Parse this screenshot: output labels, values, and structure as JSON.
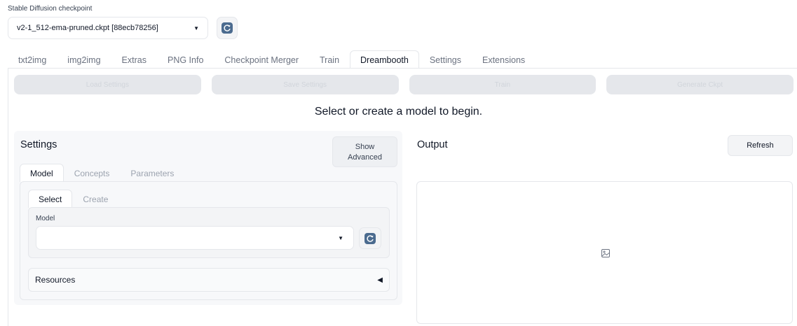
{
  "checkpoint": {
    "label": "Stable Diffusion checkpoint",
    "selected": "v2-1_512-ema-pruned.ckpt [88ecb78256]",
    "refresh_icon": "refresh-icon"
  },
  "tabs": [
    {
      "label": "txt2img"
    },
    {
      "label": "img2img"
    },
    {
      "label": "Extras"
    },
    {
      "label": "PNG Info"
    },
    {
      "label": "Checkpoint Merger"
    },
    {
      "label": "Train"
    },
    {
      "label": "Dreambooth",
      "active": true
    },
    {
      "label": "Settings"
    },
    {
      "label": "Extensions"
    }
  ],
  "actions": {
    "load_settings": "Load Settings",
    "save_settings": "Save Settings",
    "train": "Train",
    "generate_ckpt": "Generate Ckpt"
  },
  "status_message": "Select or create a model to begin.",
  "settings": {
    "title": "Settings",
    "show_advanced_line1": "Show",
    "show_advanced_line2": "Advanced",
    "subtabs": [
      {
        "label": "Model",
        "active": true
      },
      {
        "label": "Concepts"
      },
      {
        "label": "Parameters"
      }
    ],
    "model_subtabs": [
      {
        "label": "Select",
        "active": true
      },
      {
        "label": "Create"
      }
    ],
    "model_label": "Model",
    "model_value": "",
    "resources_label": "Resources"
  },
  "output": {
    "title": "Output",
    "refresh_label": "Refresh",
    "image_icon": "image-icon"
  },
  "colors": {
    "border": "#e5e7eb",
    "panel_bg": "#f7f8fa",
    "refresh_icon_bg": "#4b6b8f"
  }
}
